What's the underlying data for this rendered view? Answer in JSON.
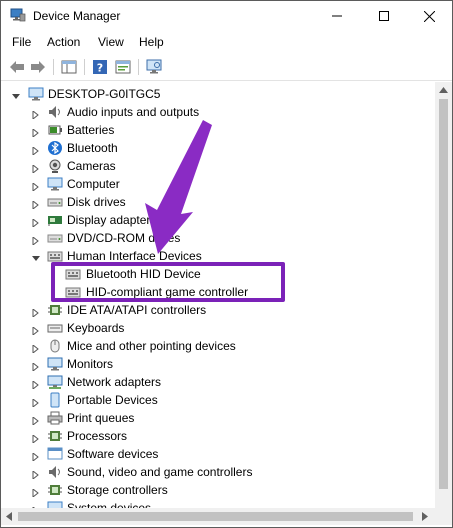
{
  "window": {
    "title": "Device Manager"
  },
  "menu": {
    "file": "File",
    "action": "Action",
    "view": "View",
    "help": "Help"
  },
  "tree": {
    "root": "DESKTOP-G0ITGC5",
    "categories": [
      {
        "label": "Audio inputs and outputs",
        "icon": "speaker-icon"
      },
      {
        "label": "Batteries",
        "icon": "battery-icon"
      },
      {
        "label": "Bluetooth",
        "icon": "bluetooth-icon"
      },
      {
        "label": "Cameras",
        "icon": "camera-icon"
      },
      {
        "label": "Computer",
        "icon": "computer-icon"
      },
      {
        "label": "Disk drives",
        "icon": "disk-drive-icon"
      },
      {
        "label": "Display adapters",
        "icon": "display-adapter-icon"
      },
      {
        "label": "DVD/CD-ROM drives",
        "icon": "dvd-drive-icon"
      },
      {
        "label": "Human Interface Devices",
        "icon": "hid-icon",
        "expanded": true
      },
      {
        "label": "IDE ATA/ATAPI controllers",
        "icon": "ide-controller-icon"
      },
      {
        "label": "Keyboards",
        "icon": "keyboard-icon"
      },
      {
        "label": "Mice and other pointing devices",
        "icon": "mouse-icon"
      },
      {
        "label": "Monitors",
        "icon": "monitor-icon"
      },
      {
        "label": "Network adapters",
        "icon": "network-adapter-icon"
      },
      {
        "label": "Portable Devices",
        "icon": "portable-device-icon"
      },
      {
        "label": "Print queues",
        "icon": "printer-icon"
      },
      {
        "label": "Processors",
        "icon": "processor-icon"
      },
      {
        "label": "Software devices",
        "icon": "software-device-icon"
      },
      {
        "label": "Sound, video and game controllers",
        "icon": "sound-icon"
      },
      {
        "label": "Storage controllers",
        "icon": "storage-controller-icon"
      },
      {
        "label": "System devices",
        "icon": "system-device-icon"
      }
    ],
    "hid_children": [
      {
        "label": "Bluetooth HID Device",
        "icon": "hid-device-icon"
      },
      {
        "label": "HID-compliant game controller",
        "icon": "hid-device-icon"
      }
    ]
  },
  "annotation": {
    "color": "#7b22b8"
  }
}
